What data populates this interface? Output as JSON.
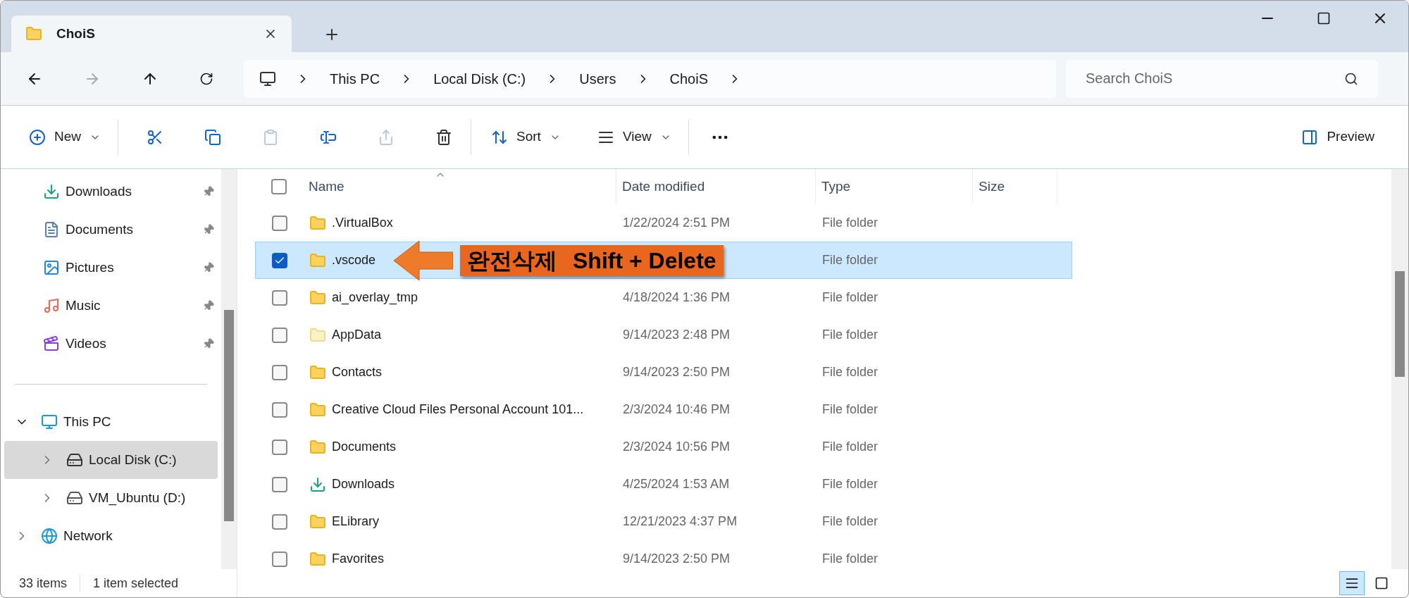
{
  "tabs": [
    {
      "title": "ChoiS",
      "selected": true
    }
  ],
  "address_bar": {
    "segments": [
      "This PC",
      "Local Disk (C:)",
      "Users",
      "ChoiS"
    ]
  },
  "search": {
    "placeholder": "Search ChoiS"
  },
  "toolbar": {
    "new_label": "New",
    "paste_disabled": true,
    "share_disabled": true,
    "sort_label": "Sort",
    "view_label": "View",
    "preview_label": "Preview"
  },
  "sidebar": {
    "quick_access": [
      {
        "label": "Downloads",
        "kind": "downloads",
        "pinned": true
      },
      {
        "label": "Documents",
        "kind": "documents",
        "pinned": true
      },
      {
        "label": "Pictures",
        "kind": "pictures",
        "pinned": true
      },
      {
        "label": "Music",
        "kind": "music",
        "pinned": true
      },
      {
        "label": "Videos",
        "kind": "videos",
        "pinned": true
      }
    ],
    "tree": [
      {
        "label": "This PC",
        "kind": "pc",
        "expanded": true,
        "selected": false,
        "children": [
          {
            "label": "Local Disk (C:)",
            "kind": "system-drive",
            "expanded": false,
            "selected": true
          },
          {
            "label": "VM_Ubuntu (D:)",
            "kind": "drive",
            "expanded": false,
            "selected": false
          }
        ]
      },
      {
        "label": "Network",
        "kind": "network",
        "expanded": false,
        "selected": false
      }
    ]
  },
  "file_list": {
    "columns": [
      "Name",
      "Date modified",
      "Type",
      "Size"
    ],
    "select_all": {
      "checked": false
    },
    "rows": [
      {
        "name": ".VirtualBox",
        "date": "1/22/2024 2:51 PM",
        "type": "File folder",
        "kind": "folder",
        "hidden": false,
        "selected": false
      },
      {
        "name": ".vscode",
        "type": "File folder",
        "kind": "folder",
        "hidden": false,
        "selected": true
      },
      {
        "name": "ai_overlay_tmp",
        "date": "4/18/2024 1:36 PM",
        "type": "File folder",
        "kind": "folder",
        "hidden": false,
        "selected": false
      },
      {
        "name": "AppData",
        "date": "9/14/2023 2:48 PM",
        "type": "File folder",
        "kind": "folder",
        "hidden": true,
        "selected": false
      },
      {
        "name": "Contacts",
        "date": "9/14/2023 2:50 PM",
        "type": "File folder",
        "kind": "folder",
        "hidden": false,
        "selected": false
      },
      {
        "name": "Creative Cloud Files Personal Account 101...",
        "date": "2/3/2024 10:46 PM",
        "type": "File folder",
        "kind": "folder",
        "hidden": false,
        "selected": false
      },
      {
        "name": "Documents",
        "date": "2/3/2024 10:56 PM",
        "type": "File folder",
        "kind": "folder",
        "hidden": false,
        "selected": false
      },
      {
        "name": "Downloads",
        "date": "4/25/2024 1:53 AM",
        "type": "File folder",
        "kind": "downloads",
        "hidden": false,
        "selected": false
      },
      {
        "name": "ELibrary",
        "date": "12/21/2023 4:37 PM",
        "type": "File folder",
        "kind": "folder",
        "hidden": false,
        "selected": false
      },
      {
        "name": "Favorites",
        "date": "9/14/2023 2:50 PM",
        "type": "File folder",
        "kind": "folder",
        "hidden": false,
        "selected": false
      }
    ]
  },
  "annotation": {
    "label": "완전삭제",
    "shortcut": "Shift + Delete"
  },
  "status_bar": {
    "count": "33 items",
    "selection": "1 item selected"
  },
  "view_buttons": [
    {
      "kind": "details",
      "selected": true
    },
    {
      "kind": "tiles",
      "selected": false
    }
  ]
}
